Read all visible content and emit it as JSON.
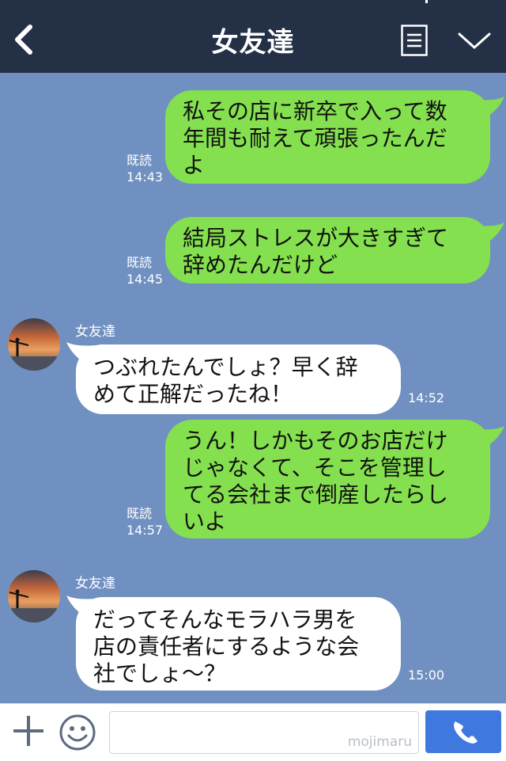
{
  "header": {
    "title": "女友達"
  },
  "icons": {
    "back": "back-chevron-icon",
    "menu": "menu-list-icon",
    "collapse": "chevron-down-icon",
    "add": "plus-icon",
    "emoji": "smiley-icon",
    "call": "phone-icon"
  },
  "messages": [
    {
      "side": "out",
      "lines": [
        "私その店に新卒で入って数",
        "年間も耐えて頑張ったんだ",
        "よ"
      ],
      "read": "既読",
      "time": "14:43"
    },
    {
      "side": "out",
      "lines": [
        "結局ストレスが大きすぎて",
        "辞めたんだけど"
      ],
      "read": "既読",
      "time": "14:45"
    },
    {
      "side": "in",
      "sender": "女友達",
      "lines": [
        "つぶれたんでしょ？早く辞",
        "めて正解だったね！"
      ],
      "time": "14:52"
    },
    {
      "side": "out",
      "lines": [
        "うん！しかもそのお店だけ",
        "じゃなくて、そこを管理し",
        "てる会社まで倒産したらし",
        "いよ"
      ],
      "read": "既読",
      "time": "14:57"
    },
    {
      "side": "in",
      "sender": "女友達",
      "lines": [
        "だってそんなモラハラ男を",
        "店の責任者にするような会",
        "社でしょ～？"
      ],
      "time": "15:00"
    }
  ],
  "footer": {
    "input_value": "",
    "watermark": "mojimaru"
  },
  "colors": {
    "header_bg": "#243046",
    "chat_bg": "#7090c1",
    "outgoing_bubble": "#84e04e",
    "incoming_bubble": "#ffffff",
    "call_button": "#3f78de"
  }
}
